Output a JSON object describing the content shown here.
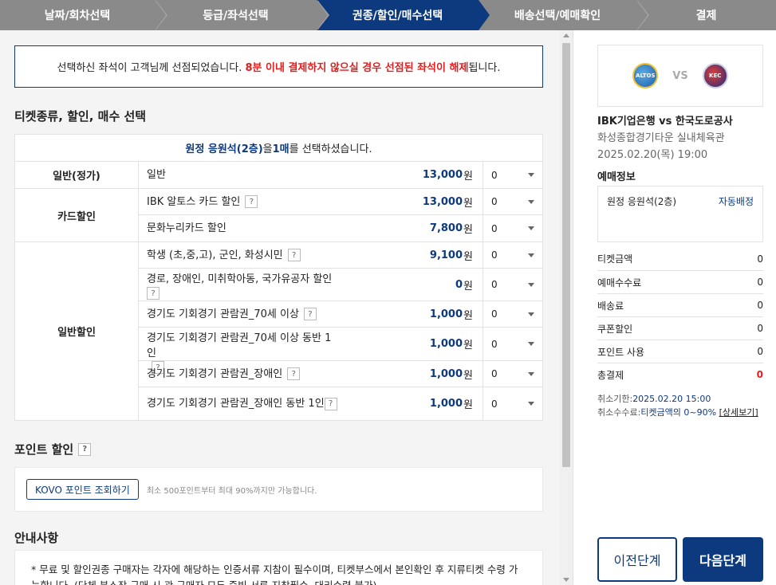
{
  "steps": [
    {
      "label": "날짜/회차선택",
      "active": false
    },
    {
      "label": "등급/좌석선택",
      "active": false
    },
    {
      "label": "권종/할인/매수선택",
      "active": true
    },
    {
      "label": "배송선택/예매확인",
      "active": false
    },
    {
      "label": "결제",
      "active": false
    }
  ],
  "notice": {
    "text_before": "선택하신 좌석이 고객님께 선점되었습니다. ",
    "text_red": "8분 이내 결제하지 않으실 경우 선점된 좌석이 해제",
    "text_after": "됩니다."
  },
  "ticket_section": {
    "title": "티켓종류, 할인, 매수 선택",
    "summary": {
      "seat": "원정 응원석(2층)",
      "mid": "을 ",
      "count": "1매",
      "end": "를 선택하셨습니다."
    },
    "groups": [
      {
        "label": "일반(정가)",
        "rows": [
          {
            "name": "일반",
            "help": false,
            "price": "13,000",
            "unit": "원",
            "qty": "0"
          }
        ]
      },
      {
        "label": "카드할인",
        "rows": [
          {
            "name": "IBK 알토스 카드 할인",
            "help": true,
            "price": "13,000",
            "unit": "원",
            "qty": "0"
          },
          {
            "name": "문화누리카드 할인",
            "help": false,
            "price": "7,800",
            "unit": "원",
            "qty": "0"
          }
        ]
      },
      {
        "label": "일반할인",
        "rows": [
          {
            "name": "학생 (초,중,고), 군인, 화성시민",
            "help": true,
            "price": "9,100",
            "unit": "원",
            "qty": "0"
          },
          {
            "name": "경로, 장애인, 미취학아동, 국가유공자 할인",
            "help": true,
            "price": "0",
            "unit": "원",
            "qty": "0"
          },
          {
            "name": "경기도 기회경기 관람권_70세 이상",
            "help": true,
            "price": "1,000",
            "unit": "원",
            "qty": "0"
          },
          {
            "name": "경기도 기회경기 관람권_70세 이상 동반 1인",
            "help": true,
            "price": "1,000",
            "unit": "원",
            "qty": "0"
          },
          {
            "name": "경기도 기회경기 관람권_장애인",
            "help": true,
            "price": "1,000",
            "unit": "원",
            "qty": "0"
          },
          {
            "name": "경기도 기회경기 관람권_장애인 동반 1인",
            "help": true,
            "price": "1,000",
            "unit": "원",
            "qty": "0"
          }
        ]
      }
    ]
  },
  "point_section": {
    "title": "포인트 할인",
    "help": "?",
    "button": "KOVO 포인트 조회하기",
    "note": "최소 500포인트부터 최대 90%까지만 가능합니다."
  },
  "guide_section": {
    "title": "안내사항",
    "text": "* 무료 및 할인권종 구매자는 각자에 해당하는 인증서류 지참이 필수이며, 티켓부스에서 본인확인 후 지류티켓 수령 가능합니다. (단체 분스장 구매 시 관 구매자 모두 증빙 서류 지참필수, 대리수령 불가)"
  },
  "help_mark": "?",
  "match": {
    "home_logo": "ALTOS",
    "away_logo": "KEC",
    "vs": "VS",
    "title": "IBK기업은행 vs 한국도로공사",
    "venue": "화성종합경기타운 실내체육관",
    "date": "2025.02.20(목) 19:00"
  },
  "booking_info": {
    "title": "예매정보",
    "seat": "원정 응원석(2층)",
    "seat_assign": "자동배정",
    "summary": [
      {
        "label": "티켓금액",
        "value": "0"
      },
      {
        "label": "예매수수료",
        "value": "0"
      },
      {
        "label": "배송료",
        "value": "0"
      },
      {
        "label": "쿠폰할인",
        "value": "0"
      },
      {
        "label": "포인트 사용",
        "value": "0"
      }
    ],
    "total_label": "총결제",
    "total_value": "0",
    "cancel_deadline_label": "취소기한:",
    "cancel_deadline": "2025.02.20 15:00",
    "cancel_fee_label": "취소수수료:",
    "cancel_fee": "티켓금액의 0~90%",
    "cancel_detail": "[상세보기]"
  },
  "buttons": {
    "prev": "이전단계",
    "next": "다음단계"
  },
  "colors": {
    "accent": "#0d3a7e",
    "alert": "#e02020",
    "step_inactive": "#8a8a8a"
  }
}
